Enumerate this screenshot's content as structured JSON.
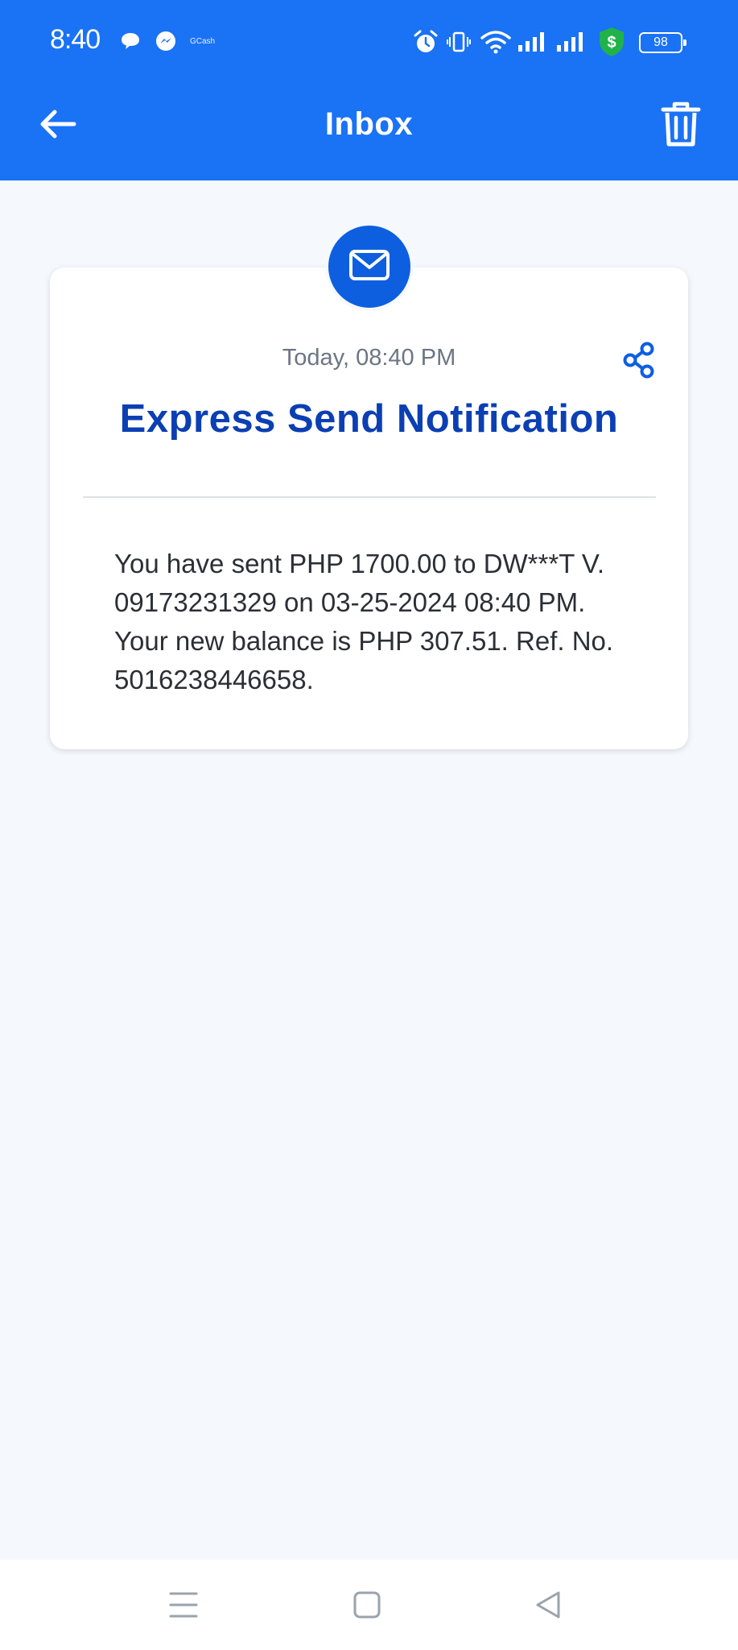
{
  "status_bar": {
    "time": "8:40",
    "notification_app_label": "GCash",
    "battery_level": "98",
    "icons": [
      "chat-bubble-icon",
      "messenger-icon",
      "alarm-icon",
      "vibrate-icon",
      "wifi-icon",
      "signal-icon",
      "signal-icon",
      "security-shield-icon",
      "battery-icon"
    ]
  },
  "app_bar": {
    "title": "Inbox",
    "back_icon": "back-arrow-icon",
    "delete_icon": "trash-icon"
  },
  "message": {
    "icon": "mail-icon",
    "date": "Today, 08:40 PM",
    "share_icon": "share-icon",
    "title": "Express Send Notification",
    "body": "You have sent PHP 1700.00 to DW***T V. 09173231329 on 03-25-2024 08:40 PM. Your new balance is PHP 307.51. Ref. No. 5016238446658."
  },
  "nav_bar": {
    "buttons": [
      "menu-icon",
      "home-icon",
      "back-triangle-icon"
    ]
  },
  "colors": {
    "header": "#1a72f5",
    "page_background": "#f5f9fe",
    "title_blue": "#0b3fb3",
    "badge_blue": "#0d5fe0",
    "shield_green": "#21b24b"
  }
}
